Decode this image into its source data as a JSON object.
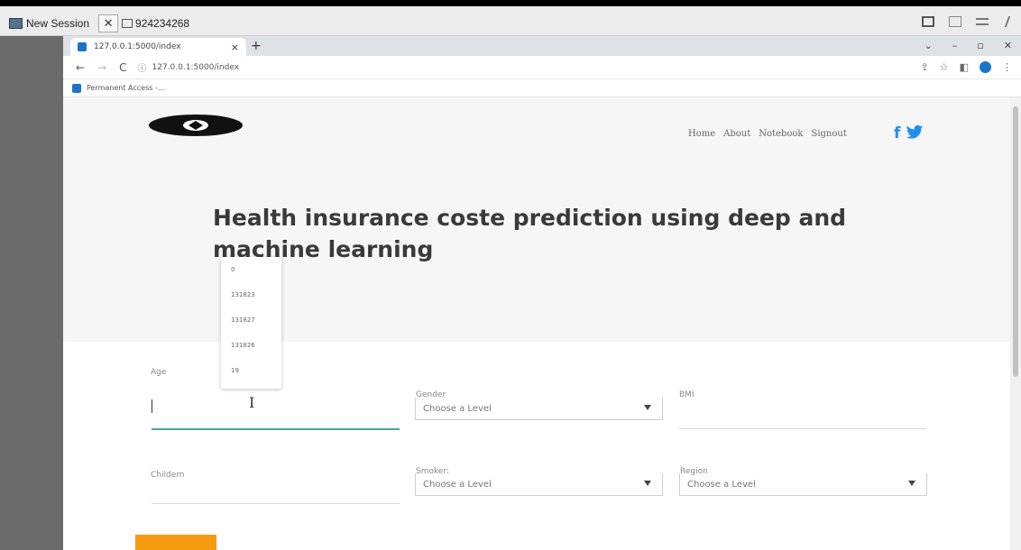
{
  "remote_desktop": {
    "session_label": "New Session",
    "session_id": "924234268"
  },
  "browser": {
    "tab_title": "127.0.0.1:5000/index",
    "address_url": "127.0.0.1:5000/index",
    "bookmark_label": "Permanent Access -..."
  },
  "site": {
    "nav": {
      "home": "Home",
      "about": "About",
      "notebook": "Notebook",
      "signout": "Signout"
    },
    "social": {
      "facebook": "f",
      "twitter": "t"
    },
    "title": "Health insurance coste prediction using deep and machine learning"
  },
  "autocomplete_options": [
    "0",
    "131823",
    "131827",
    "131826",
    "19"
  ],
  "form": {
    "age_label": "Age",
    "gender_label": "Gender",
    "gender_value": "Choose a Level",
    "bmi_label": "BMI",
    "children_label": "Childern",
    "smoker_label": "Smoker:",
    "smoker_value": "Choose a Level",
    "region_label": "Region",
    "region_value": "Choose a Level"
  },
  "colors": {
    "accent_teal": "#4aa79b",
    "social_blue": "#1d8ff1",
    "button_orange": "#f59b10"
  }
}
